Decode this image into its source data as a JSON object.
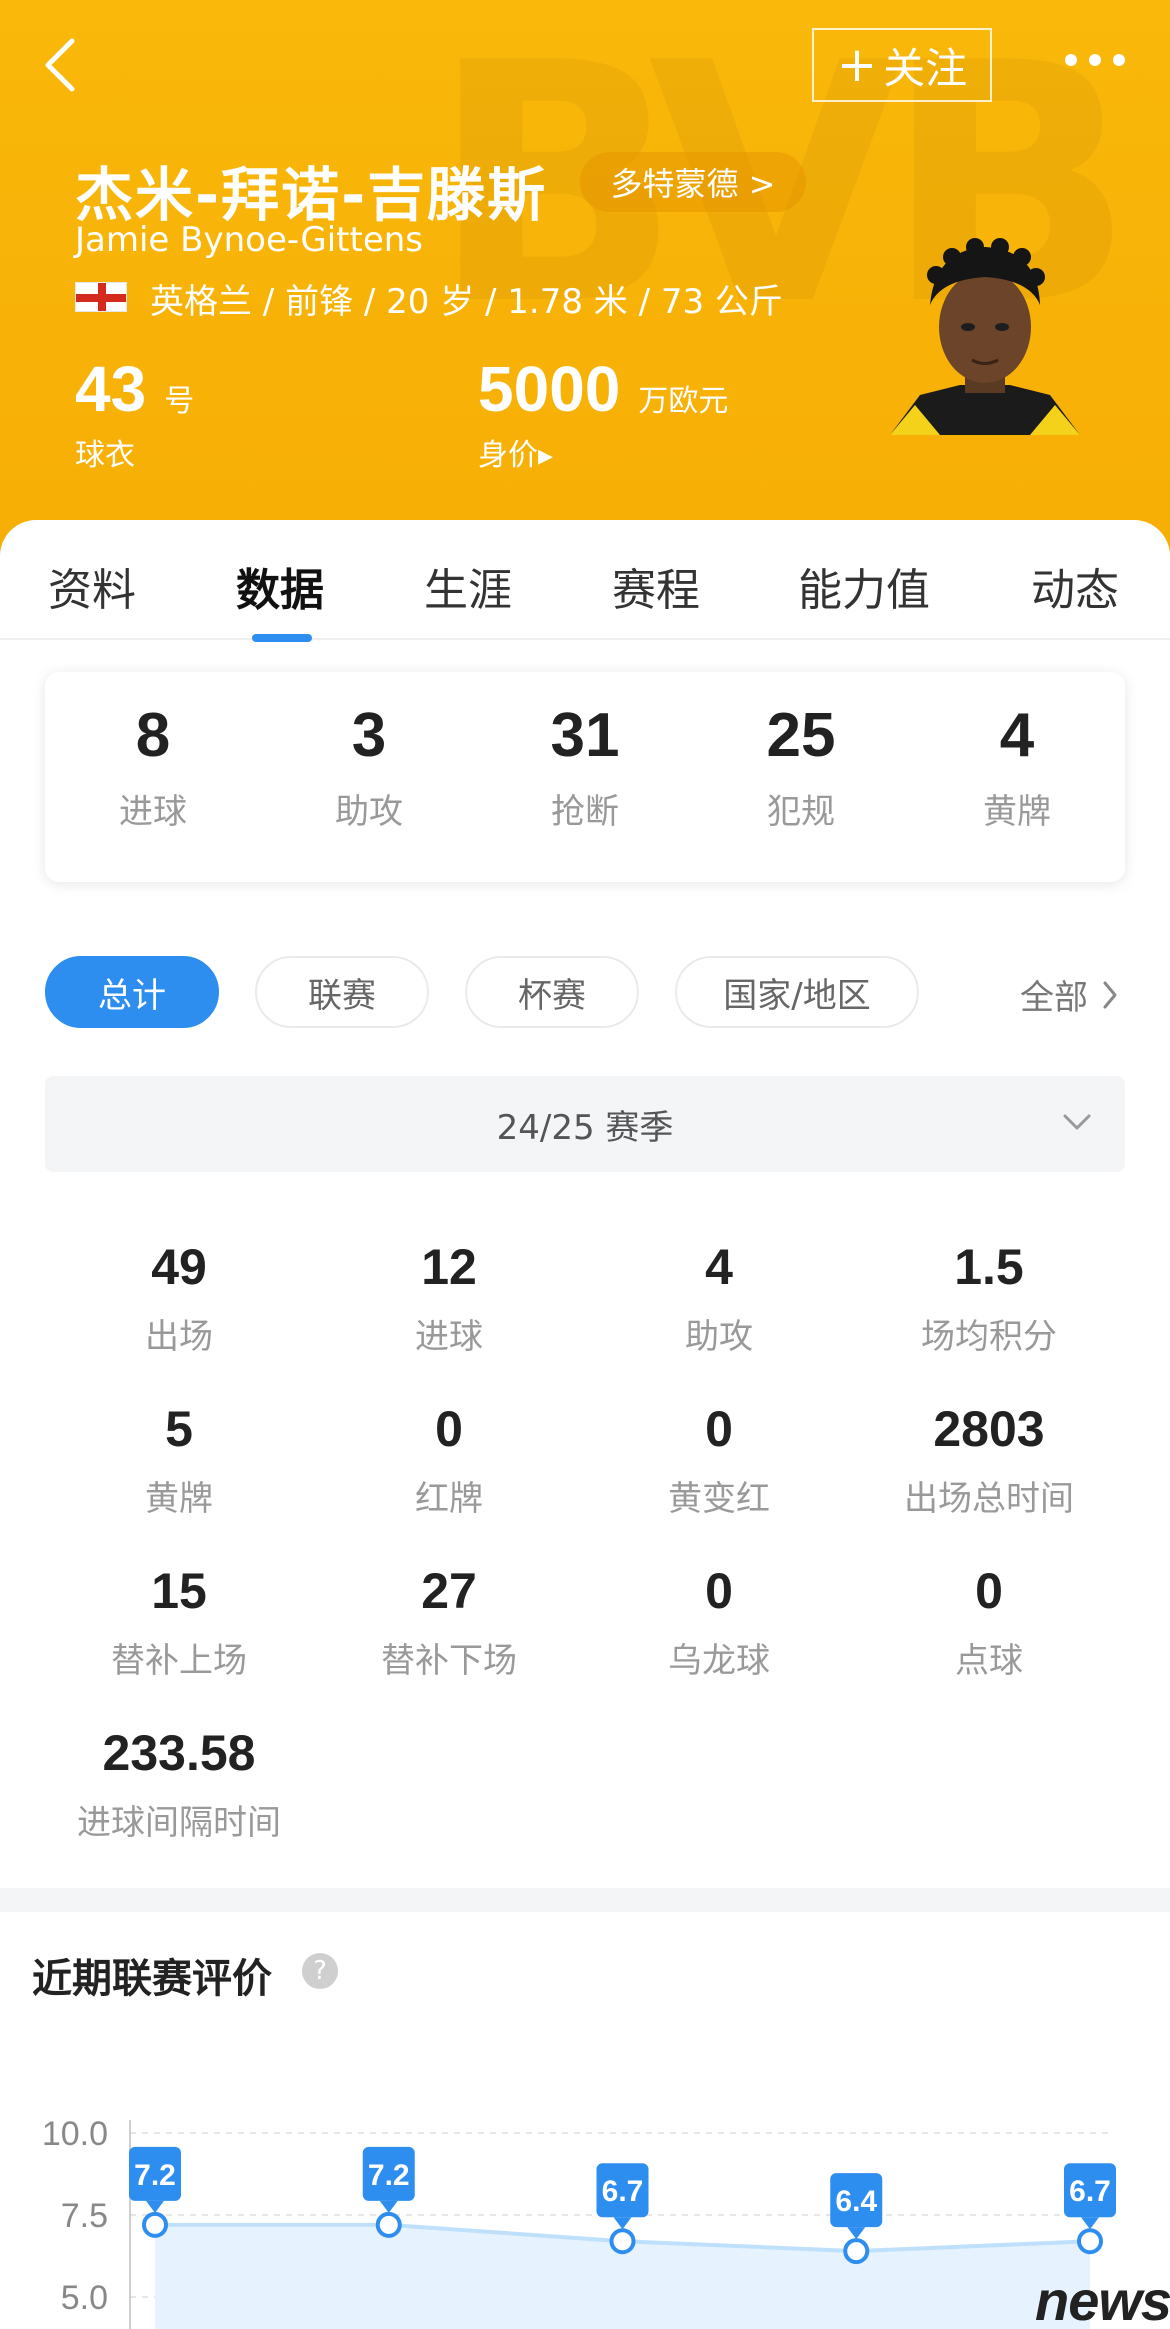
{
  "header": {
    "watermark": "BVB",
    "follow_label": "关注",
    "player_name": "杰米-拜诺-吉滕斯",
    "club_label": "多特蒙德 >",
    "player_name_en": "Jamie Bynoe-Gittens",
    "meta": "英格兰 / 前锋 / 20 岁 / 1.78 米 / 73 公斤",
    "shirt_number": "43",
    "shirt_unit": "号",
    "shirt_label": "球衣",
    "market_value": "5000",
    "market_value_unit": "万欧元",
    "market_value_label": "身价▸",
    "icons": [
      "back-chevron-icon",
      "plus-icon",
      "more-dots-icon",
      "england-flag-icon"
    ],
    "colors": {
      "header_bg": "#f9b80a",
      "accent_blue": "#2e8ef0"
    }
  },
  "tabs": [
    {
      "label": "资料"
    },
    {
      "label": "数据",
      "active": true
    },
    {
      "label": "生涯"
    },
    {
      "label": "赛程"
    },
    {
      "label": "能力值"
    },
    {
      "label": "动态"
    }
  ],
  "summary": [
    {
      "value": "8",
      "label": "进球"
    },
    {
      "value": "3",
      "label": "助攻"
    },
    {
      "value": "31",
      "label": "抢断"
    },
    {
      "value": "25",
      "label": "犯规"
    },
    {
      "value": "4",
      "label": "黄牌"
    }
  ],
  "filters": {
    "pills": [
      {
        "label": "总计",
        "active": true
      },
      {
        "label": "联赛"
      },
      {
        "label": "杯赛"
      },
      {
        "label": "国家/地区"
      }
    ],
    "all_label": "全部"
  },
  "season": {
    "selected": "24/25 赛季"
  },
  "stats": [
    {
      "value": "49",
      "label": "出场"
    },
    {
      "value": "12",
      "label": "进球"
    },
    {
      "value": "4",
      "label": "助攻"
    },
    {
      "value": "1.5",
      "label": "场均积分"
    },
    {
      "value": "5",
      "label": "黄牌"
    },
    {
      "value": "0",
      "label": "红牌"
    },
    {
      "value": "0",
      "label": "黄变红"
    },
    {
      "value": "2803",
      "label": "出场总时间"
    },
    {
      "value": "15",
      "label": "替补上场"
    },
    {
      "value": "27",
      "label": "替补下场"
    },
    {
      "value": "0",
      "label": "乌龙球"
    },
    {
      "value": "0",
      "label": "点球"
    },
    {
      "value": "233.58",
      "label": "进球间隔时间"
    }
  ],
  "rating_section": {
    "title": "近期联赛评价",
    "help_icon": "?"
  },
  "chart_data": {
    "type": "area",
    "title": "",
    "x": [
      1,
      2,
      3,
      4,
      5
    ],
    "values": [
      7.2,
      7.2,
      6.7,
      6.4,
      6.7
    ],
    "data_labels": [
      "7.2",
      "7.2",
      "6.7",
      "6.4",
      "6.7"
    ],
    "ytick_labels": [
      "10.0",
      "7.5",
      "5.0"
    ],
    "yticks": [
      10.0,
      7.5,
      5.0
    ],
    "ylim": [
      5.0,
      10.0
    ],
    "grid": true,
    "colors": {
      "line": "#bfe0fb",
      "fill": "#e6f2fd",
      "point": "#2e8ef0",
      "label_bg": "#2e8ef0"
    }
  },
  "footer": {
    "logo": "news"
  }
}
